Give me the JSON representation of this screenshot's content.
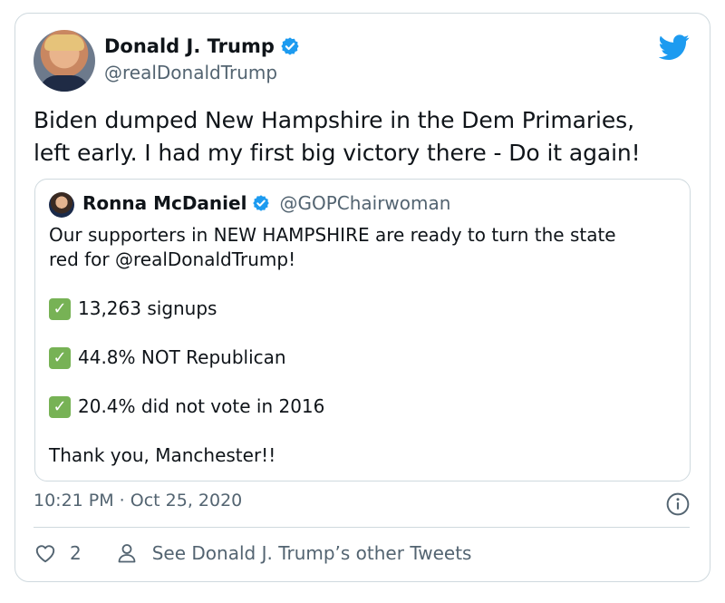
{
  "author": {
    "name": "Donald J. Trump",
    "handle": "@realDonaldTrump"
  },
  "tweet_text_lines": [
    "Biden dumped New Hampshire in the Dem Primaries,",
    "left early. I had my first big victory there - Do it again!"
  ],
  "quoted": {
    "name": "Ronna McDaniel",
    "handle": "@GOPChairwoman",
    "lines": [
      "Our supporters in NEW HAMPSHIRE are ready to turn the state",
      "red for @realDonaldTrump!"
    ],
    "checks": [
      "13,263 signups",
      "44.8% NOT Republican",
      "20.4% did not vote in 2016"
    ],
    "closing": "Thank you, Manchester!!"
  },
  "timestamp": "10:21 PM · Oct 25, 2020",
  "actions": {
    "likes": "2",
    "see_more": "See Donald J. Trump’s other Tweets"
  },
  "colors": {
    "verified_blue": "#1d9bf0",
    "check_green": "#77b255",
    "secondary_text": "#536471",
    "border": "#cfd9de"
  },
  "icons": [
    "twitter-logo-icon",
    "verified-badge-icon",
    "info-icon",
    "heart-icon",
    "person-icon",
    "check-mark-icon"
  ]
}
